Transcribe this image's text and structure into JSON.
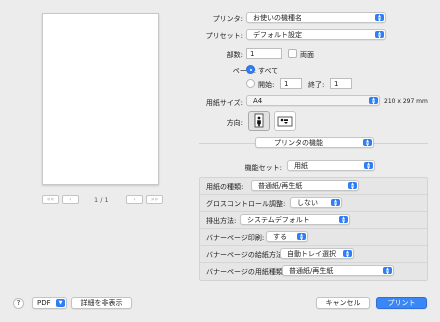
{
  "preview": {
    "page_indicator": "1 / 1",
    "first_icon": "««",
    "prev_icon": "‹",
    "next_icon": "›",
    "last_icon": "»»"
  },
  "printer": {
    "label": "プリンタ:",
    "value": "お使いの機種名"
  },
  "preset": {
    "label": "プリセット:",
    "value": "デフォルト設定"
  },
  "copies": {
    "label": "部数:",
    "value": "1",
    "duplex_label": "両面"
  },
  "pages": {
    "label": "ページ:",
    "all_label": "すべて",
    "from_label": "開始:",
    "from_value": "1",
    "to_label": "終了:",
    "to_value": "1"
  },
  "paper_size": {
    "label": "用紙サイズ:",
    "value": "A4",
    "dimensions": "210 x 297 mm"
  },
  "orientation": {
    "label": "方向:"
  },
  "section": {
    "value": "プリンタの機能"
  },
  "feature_set": {
    "label": "機能セット:",
    "value": "用紙"
  },
  "features": {
    "paper_type": {
      "label": "用紙の種類:",
      "value": "普通紙/再生紙"
    },
    "gloss": {
      "label": "グロスコントロール調整:",
      "value": "しない"
    },
    "output": {
      "label": "排出方法:",
      "value": "システムデフォルト"
    },
    "banner_print": {
      "label": "バナーページ印刷:",
      "value": "する"
    },
    "banner_source": {
      "label": "バナーページの給紙方法:",
      "value": "自動トレイ選択"
    },
    "banner_type": {
      "label": "バナーページの用紙種類:",
      "value": "普通紙/再生紙"
    }
  },
  "footer": {
    "help": "?",
    "pdf": "PDF",
    "hide_details": "詳細を非表示",
    "cancel": "キャンセル",
    "print": "プリント"
  },
  "colors": {
    "accent": "#2f7ef6",
    "window": "#ececec"
  }
}
